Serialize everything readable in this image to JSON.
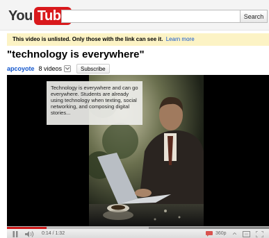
{
  "header": {
    "logo_you": "You",
    "logo_tube": "Tube",
    "search": {
      "value": "",
      "placeholder": ""
    },
    "search_button_label": "Search"
  },
  "notice": {
    "text": "This video is unlisted. Only those with the link can see it.",
    "link_label": "Learn more"
  },
  "video": {
    "title": "\"technology is everywhere\"",
    "channel": "apcoyote",
    "video_count": "8 videos",
    "subscribe_label": "Subscribe",
    "annotation": "Technology is everywhere and can go everywhere. Students are already using technology when texting, social networking, and composing digital stories..."
  },
  "player": {
    "time": "0:14 / 1:32",
    "quality": "360p",
    "progress_played": 0.15,
    "progress_loaded": 0.54
  },
  "icons": {
    "pause": "pause-icon",
    "volume": "volume-icon",
    "annotation": "speech-bubble-icon",
    "popout": "popout-icon",
    "expand": "expand-icon"
  },
  "colors": {
    "logo_red": "#d9191c",
    "notice_bg": "#fcf3c5",
    "link_blue": "#1155cc",
    "progress_red": "#cc1818"
  }
}
